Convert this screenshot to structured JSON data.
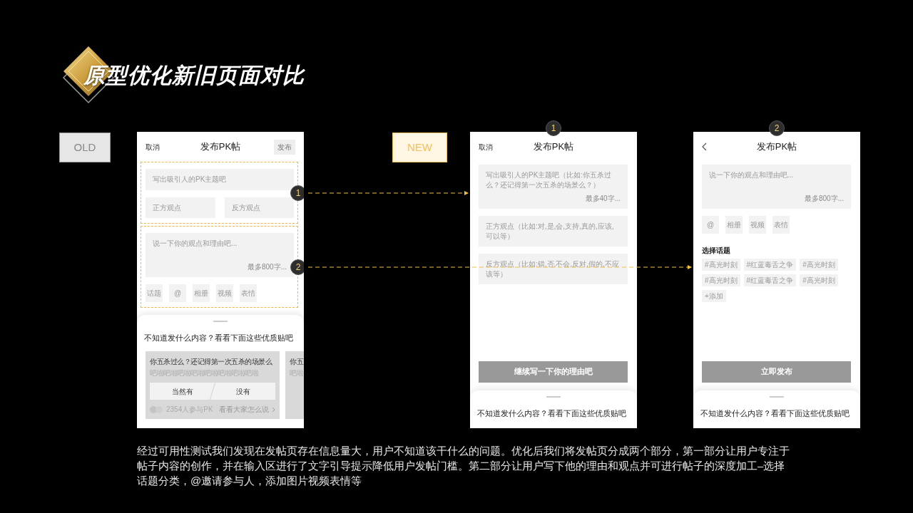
{
  "title": "原型优化新旧页面对比",
  "old_label": "OLD",
  "old_screen": {
    "header": {
      "nav": {
        "kind": "text",
        "label": "取消"
      },
      "title": "发布PK帖",
      "action": "发布"
    },
    "sections": [
      {
        "callout": "1",
        "blocks": [
          {
            "kind": "input",
            "placeholder": "写出吸引人的PK主题吧"
          },
          {
            "kind": "pair",
            "placeholders": [
              "正方观点",
              "反方观点"
            ]
          }
        ]
      },
      {
        "callout": "2",
        "blocks": [
          {
            "kind": "textarea",
            "placeholder": "说一下你的观点和理由吧...",
            "counter": "最多800字..."
          },
          {
            "kind": "tools",
            "items": [
              "话题",
              "@",
              "相册",
              "视频",
              "表情"
            ]
          }
        ]
      }
    ],
    "sheet": {
      "heading": "不知道发什么内容？看看下面这些优质贴吧",
      "cards": [
        {
          "title": "你五杀过么？还记得第一次五杀的场景么",
          "subtitle": "吧啦吧啦吧啦吧啦吧啦吧啦吧啦吧啦",
          "options": [
            "当然有",
            "没有"
          ],
          "count": "2354人参与PK",
          "link": "看看大家怎么说"
        },
        {
          "title": "你五",
          "subtitle": "吧啦"
        }
      ]
    }
  },
  "new_label": "NEW",
  "new_screens": [
    {
      "badge": "1",
      "header": {
        "nav": {
          "kind": "text",
          "label": "取消"
        },
        "title": "发布PK帖"
      },
      "sections": [
        {
          "blocks": [
            {
              "kind": "textarea",
              "placeholder": "写出吸引人的PK主题吧（比如:你五杀过么？还记得第一次五杀的场景么？）",
              "counter": "最多40字..."
            },
            {
              "kind": "input",
              "placeholder": "正方观点（比如:对,是,会,支持,真的,应该,可以等）"
            },
            {
              "kind": "input",
              "placeholder": "反方观点（比如:错,否,不会,反对,假的,不应该等）"
            }
          ]
        }
      ],
      "submit": "继续写一下你的理由吧",
      "sheet": {
        "heading": "不知道发什么内容？看看下面这些优质贴吧"
      }
    },
    {
      "badge": "2",
      "header": {
        "nav": {
          "kind": "back"
        },
        "title": "发布PK帖"
      },
      "sections": [
        {
          "blocks": [
            {
              "kind": "textarea",
              "placeholder": "说一下你的观点和理由吧...",
              "counter": "最多800字..."
            },
            {
              "kind": "tools",
              "items": [
                "@",
                "相册",
                "视频",
                "表情"
              ]
            },
            {
              "kind": "topics",
              "heading": "选择话题",
              "tags": [
                "#高光时刻",
                "#红蓝毒舌之争",
                "#高光时刻",
                "#高光时刻",
                "#红蓝毒舌之争",
                "#高光时刻",
                "+添加"
              ]
            }
          ]
        }
      ],
      "submit": "立即发布",
      "sheet": {
        "heading": "不知道发什么内容？看看下面这些优质贴吧"
      }
    }
  ],
  "description": "经过可用性测试我们发现在发帖页存在信息量大，用户不知道该干什么的问题。优化后我们将发帖页分成两个部分，第一部分让用户专注于帖子内容的创作，并在输入区进行了文字引导提示降低用户发帖门槛。第二部分让用户写下他的理由和观点并可进行帖子的深度加工–选择话题分类，@邀请参与人，添加图片视频表情等"
}
